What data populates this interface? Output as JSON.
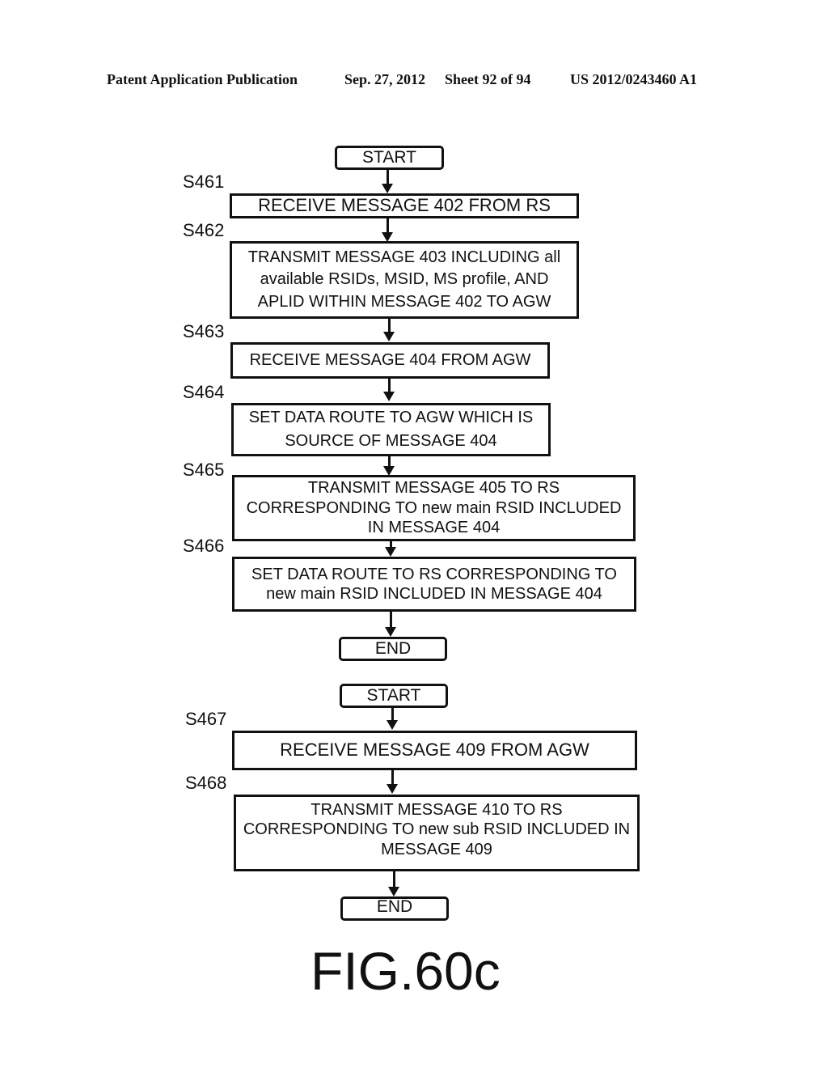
{
  "header": {
    "publication": "Patent Application Publication",
    "date": "Sep. 27, 2012",
    "sheet": "Sheet 92 of 94",
    "number": "US 2012/0243460 A1"
  },
  "flow1": {
    "start": "START",
    "steps": [
      {
        "id": "S461",
        "text": "RECEIVE MESSAGE 402 FROM RS"
      },
      {
        "id": "S462",
        "text": "TRANSMIT MESSAGE 403 INCLUDING all available RSIDs, MSID, MS profile, AND APLID WITHIN MESSAGE 402 TO AGW"
      },
      {
        "id": "S463",
        "text": "RECEIVE MESSAGE 404 FROM AGW"
      },
      {
        "id": "S464",
        "text": "SET DATA ROUTE TO AGW WHICH IS SOURCE OF MESSAGE 404"
      },
      {
        "id": "S465",
        "text": "TRANSMIT MESSAGE 405 TO RS CORRESPONDING TO new main RSID INCLUDED IN MESSAGE 404"
      },
      {
        "id": "S466",
        "text": "SET DATA ROUTE TO RS CORRESPONDING TO new main RSID INCLUDED IN MESSAGE 404"
      }
    ],
    "end": "END"
  },
  "flow2": {
    "start": "START",
    "steps": [
      {
        "id": "S467",
        "text": "RECEIVE MESSAGE 409 FROM AGW"
      },
      {
        "id": "S468",
        "text": "TRANSMIT MESSAGE 410 TO RS CORRESPONDING TO new sub RSID INCLUDED IN MESSAGE 409"
      }
    ],
    "end": "END"
  },
  "figure_label": "FIG.60c"
}
